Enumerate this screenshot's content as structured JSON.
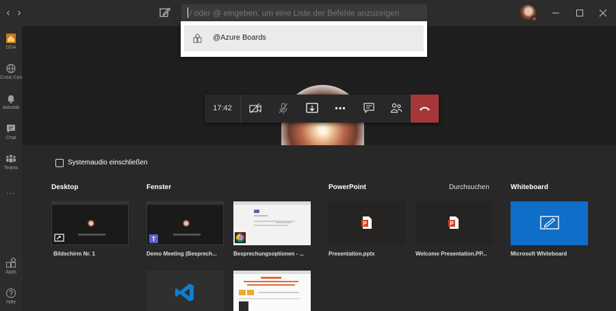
{
  "titlebar": {
    "nav_back": "‹",
    "nav_forward": "›",
    "command_placeholder": "/ oder @ eingeben, um eine Liste der Befehle anzuzeigen"
  },
  "dropdown": {
    "items": [
      {
        "label": "@Azure Boards"
      }
    ]
  },
  "rail": {
    "items": [
      {
        "label": "DDA"
      },
      {
        "label": "Crisis Com..."
      },
      {
        "label": "Aktivität"
      },
      {
        "label": "Chat"
      },
      {
        "label": "Teams"
      },
      {
        "label": "..."
      },
      {
        "label": "Apps"
      },
      {
        "label": "Hilfe"
      }
    ]
  },
  "call": {
    "timer": "17:42"
  },
  "share": {
    "system_audio_label": "Systemaudio einschließen",
    "sections": {
      "desktop": "Desktop",
      "window": "Fenster",
      "powerpoint": "PowerPoint",
      "browse": "Durchsuchen",
      "whiteboard": "Whiteboard"
    },
    "desktop_items": [
      {
        "caption": "Bildschirm Nr. 1"
      }
    ],
    "window_items": [
      {
        "caption": "Demo Meeting (Besprech..."
      },
      {
        "caption": "Besprechungsoptionen - ..."
      }
    ],
    "powerpoint_items": [
      {
        "caption": "Presentation.pptx"
      },
      {
        "caption": "Welcome Presentation.PP..."
      }
    ],
    "whiteboard_items": [
      {
        "caption": "Microsoft Whiteboard"
      }
    ]
  },
  "colors": {
    "hangup": "#a4373a",
    "whiteboard": "#0f6ec8",
    "accent": "#c4314b",
    "powerpoint": "#d04423"
  }
}
